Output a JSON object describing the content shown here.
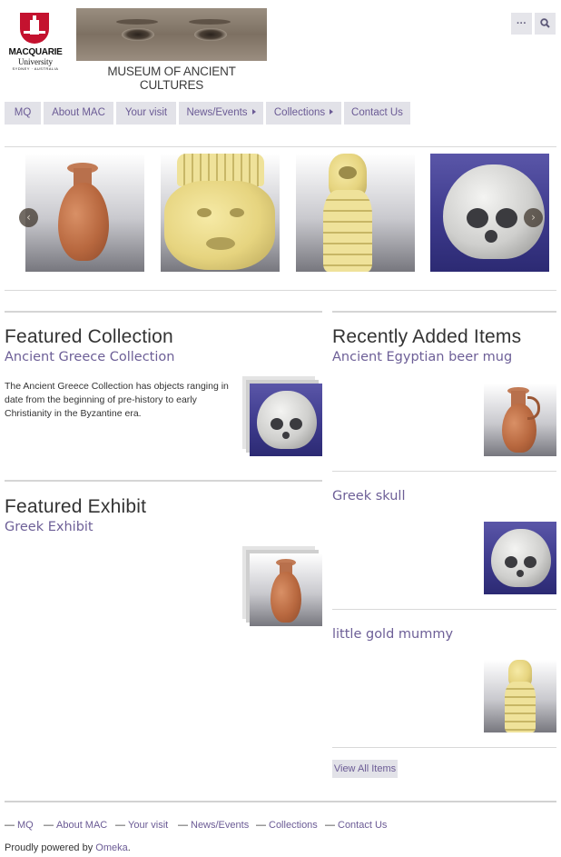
{
  "header": {
    "logo_line1": "MACQUARIE",
    "logo_line2": "University",
    "logo_line3": "SYDNEY · AUSTRALIA",
    "banner_title": "MUSEUM OF ANCIENT CULTURES",
    "menu_icon": "ellipsis-icon",
    "search_icon": "search-icon"
  },
  "nav": {
    "items": [
      {
        "label": "MQ"
      },
      {
        "label": "About MAC"
      },
      {
        "label": "Your visit"
      },
      {
        "label": "News/Events",
        "has_submenu": true
      },
      {
        "label": "Collections",
        "has_submenu": true
      },
      {
        "label": "Contact Us"
      }
    ]
  },
  "carousel": {
    "prev_icon": "chevron-left-icon",
    "next_icon": "chevron-right-icon",
    "slides": [
      "vase",
      "gold-amulet",
      "gold-mummy",
      "skull"
    ]
  },
  "featured_collection": {
    "heading": "Featured Collection",
    "title": "Ancient Greece Collection",
    "description": "The Ancient Greece Collection has objects ranging in date from the beginning of pre-history to early Christianity in the Byzantine era."
  },
  "featured_exhibit": {
    "heading": "Featured Exhibit",
    "title": "Greek Exhibit"
  },
  "recent_items": {
    "heading": "Recently Added Items",
    "items": [
      {
        "title": "Ancient Egyptian beer mug"
      },
      {
        "title": "Greek skull"
      },
      {
        "title": "little gold mummy"
      }
    ],
    "view_all_label": "View All Items"
  },
  "footer": {
    "links": [
      "MQ",
      "About MAC",
      "Your visit",
      "News/Events",
      "Collections",
      "Contact Us"
    ],
    "powered_prefix": "Proudly powered by ",
    "powered_link": "Omeka",
    "powered_suffix": "."
  },
  "colors": {
    "link": "#6d5f97",
    "nav_bg": "#e2e2e8",
    "university_red": "#c4122f"
  }
}
